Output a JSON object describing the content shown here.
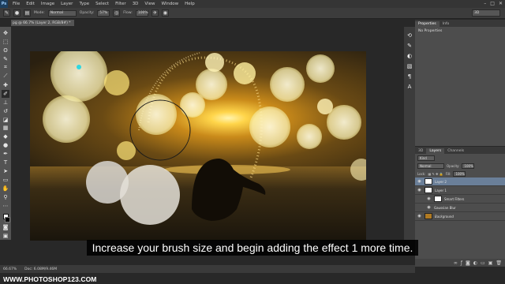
{
  "app": {
    "logo": "Ps"
  },
  "menu": [
    "File",
    "Edit",
    "Image",
    "Layer",
    "Type",
    "Select",
    "Filter",
    "3D",
    "View",
    "Window",
    "Help"
  ],
  "window_controls": [
    "–",
    "□",
    "✕"
  ],
  "options_bar": {
    "mode_label": "Mode:",
    "mode_value": "Normal",
    "opacity_label": "Opacity:",
    "opacity_value": "57%",
    "flow_label": "Flow:",
    "flow_value": "100%",
    "workspace": "3D"
  },
  "document": {
    "tab_title": "pg @ 66.7% (Layer 2, RGB/8#) *"
  },
  "properties_panel": {
    "tabs": [
      "Properties",
      "Info"
    ],
    "title": "No Properties"
  },
  "layers_panel": {
    "tabs": [
      "3D",
      "Layers",
      "Channels"
    ],
    "kind_label": "Kind",
    "blend_mode": "Normal",
    "opacity_label": "Opacity:",
    "opacity_value": "100%",
    "lock_label": "Lock:",
    "fill_label": "Fill:",
    "fill_value": "100%",
    "layers": [
      {
        "name": "Layer 2",
        "selected": true
      },
      {
        "name": "Layer 1",
        "selected": false
      },
      {
        "name": "Smart Filters",
        "selected": false
      },
      {
        "name": "Gaussian Blur",
        "selected": false
      },
      {
        "name": "Background",
        "selected": false
      }
    ]
  },
  "status_bar": {
    "zoom": "66.67%",
    "doc_info": "Doc: 6.08M/9.46M"
  },
  "caption": "Increase your brush size and begin adding the effect 1 more time.",
  "watermark": "WWW.PHOTOSHOP123.COM",
  "colors": {
    "bokeh": "#f6f0a8",
    "sky_top": "#2e2410",
    "sun": "#ffd24a",
    "water": "#2a2316",
    "selected_layer": "#6a7f99"
  }
}
